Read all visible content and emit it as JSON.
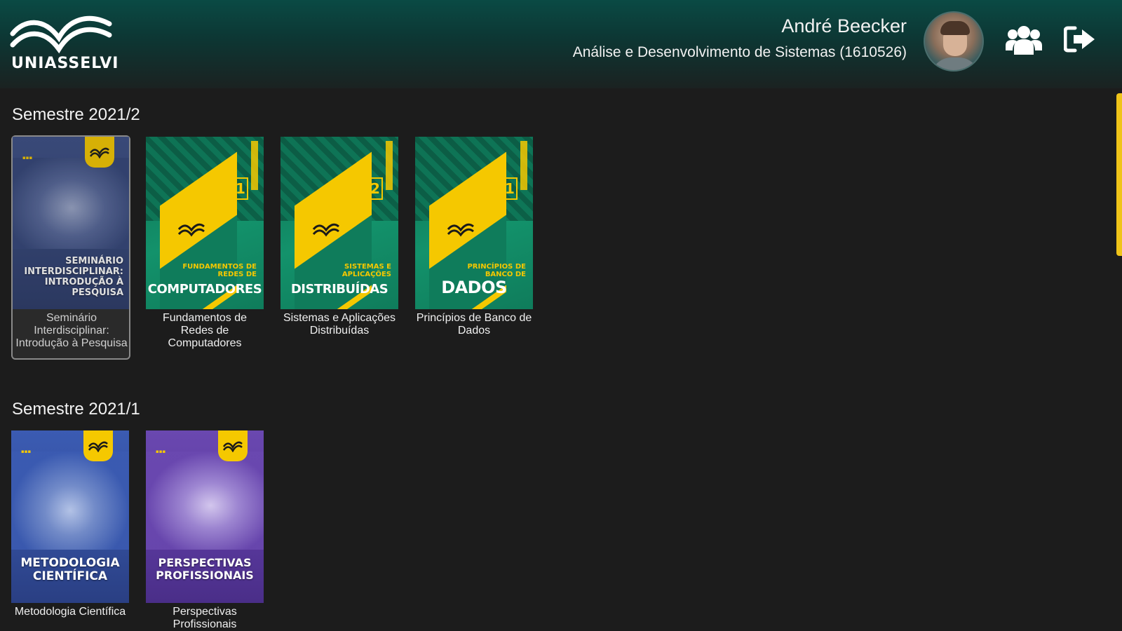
{
  "header": {
    "logo_text": "UNIASSELVI",
    "user_name": "André Beecker",
    "user_course": "Análise e Desenvolvimento de Sistemas (1610526)",
    "background_color": "#0a4a44",
    "icons": [
      "users-group-icon",
      "logout-icon"
    ]
  },
  "sections": [
    {
      "title": "Semestre 2021/2",
      "courses": [
        {
          "label": "Seminário Interdisciplinar: Introdução à Pesquisa",
          "cover_title": "SEMINÁRIO INTERDISCIPLINAR: INTRODUÇÃO À PESQUISA",
          "cover_color": "#34467a",
          "selected": true
        },
        {
          "label": "Fundamentos de Redes de Computadores",
          "cover_subtitle": "FUNDAMENTOS DE REDES DE",
          "cover_title": "COMPUTADORES",
          "volume": "1",
          "cover_color": "#13926b"
        },
        {
          "label": "Sistemas e Aplicações Distribuídas",
          "cover_subtitle": "SISTEMAS E APLICAÇÕES",
          "cover_title": "DISTRIBUÍDAS",
          "volume": "2",
          "cover_color": "#13926b"
        },
        {
          "label": "Princípios de Banco de Dados",
          "cover_subtitle": "PRINCÍPIOS DE BANCO DE",
          "cover_title": "DADOS",
          "volume": "1",
          "cover_color": "#13926b"
        }
      ]
    },
    {
      "title": "Semestre 2021/1",
      "courses": [
        {
          "label": "Metodologia Científica",
          "cover_title": "METODOLOGIA CIENTÍFICA",
          "cover_color": "#334f9e"
        },
        {
          "label": "Perspectivas Profissionais",
          "cover_title": "PERSPECTIVAS PROFISSIONAIS",
          "cover_color": "#5b3aa0"
        }
      ]
    }
  ],
  "accent_color": "#f5c800"
}
